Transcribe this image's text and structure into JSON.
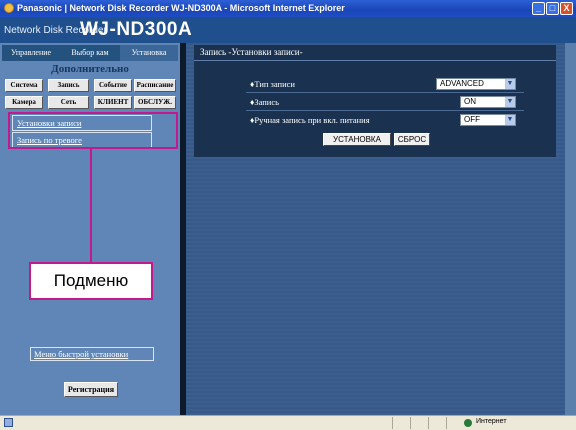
{
  "window": {
    "title": "Panasonic | Network Disk Recorder WJ-ND300A - Microsoft Internet Explorer",
    "buttons": [
      "_",
      "□",
      "X"
    ]
  },
  "header": {
    "brand": "Network Disk Recorder",
    "model": "WJ-ND300A"
  },
  "tabs": [
    "Управление",
    "Выбор кам",
    "Установка"
  ],
  "sidebar": {
    "section_title": "Дополнительно",
    "buttons_row1": [
      "Система",
      "Запись",
      "Событие",
      "Расписание"
    ],
    "buttons_row2": [
      "Камера",
      "Сеть",
      "КЛИЕНТ",
      "ОБСЛУЖ."
    ],
    "submenu": [
      "Установки записи",
      "Запись по тревоге"
    ],
    "quick_setup": "Меню быстрой установки",
    "register_button": "Регистрация"
  },
  "annotation": {
    "callout": "Подменю",
    "color": "#c21a8c"
  },
  "main": {
    "title": "Запись -Установки записи-",
    "rows": [
      {
        "label": "♦Тип записи",
        "value": "ADVANCED"
      },
      {
        "label": "♦Запись",
        "value": "ON"
      },
      {
        "label": "♦Ручная запись при вкл. питания",
        "value": "OFF"
      }
    ],
    "set_button": "УСТАНОВКА",
    "reset_button": "СБРОС"
  },
  "statusbar": {
    "zone": "Интернет"
  }
}
